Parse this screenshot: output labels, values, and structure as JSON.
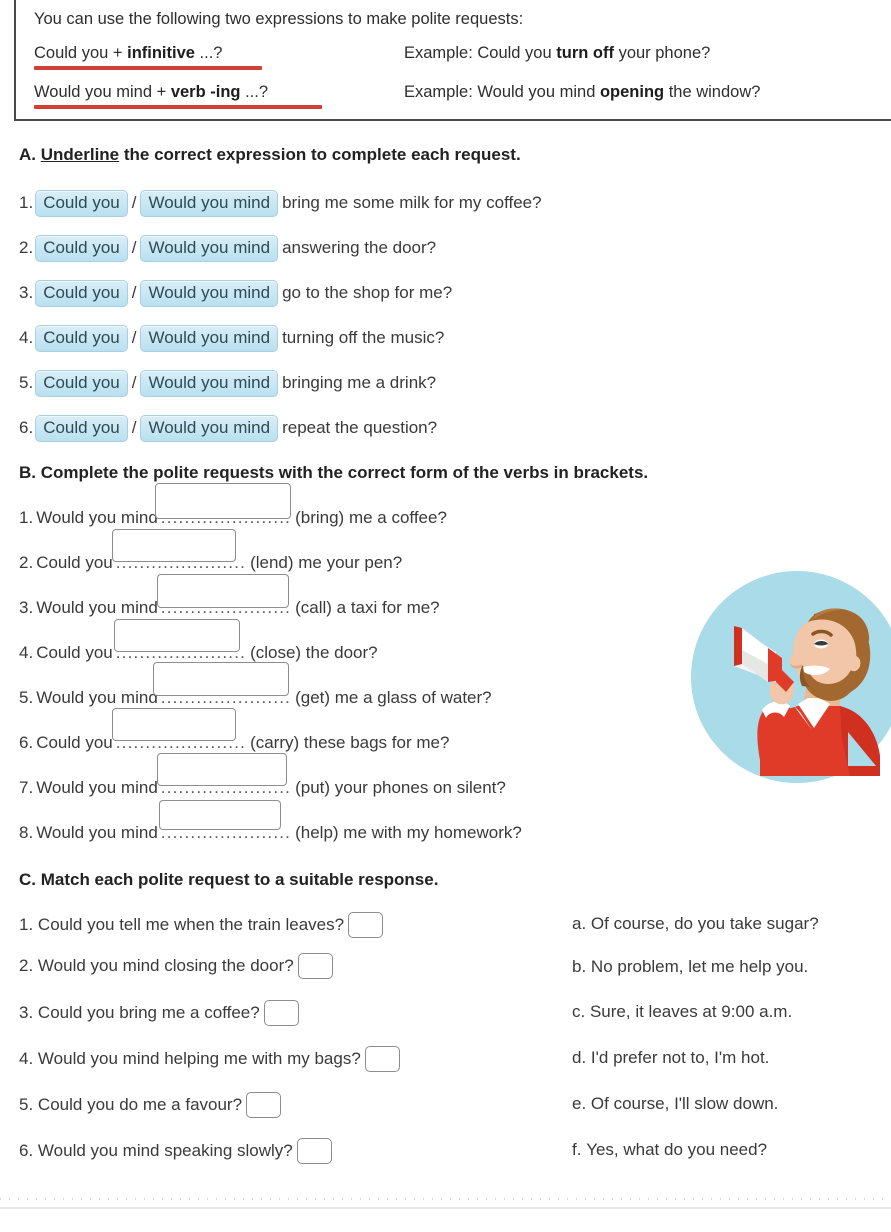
{
  "grammar_box": {
    "intro": "You can use the following two expressions to make polite requests:",
    "rows": [
      {
        "formula_prefix": "Could you + ",
        "formula_bold": "infinitive",
        "formula_suffix": " ...?",
        "example_prefix": "Example: Could you ",
        "example_bold": "turn off",
        "example_suffix": " your phone?"
      },
      {
        "formula_prefix": "Would you mind + ",
        "formula_bold": "verb -ing",
        "formula_suffix": " ...?",
        "example_prefix": "Example: Would you mind ",
        "example_bold": "opening",
        "example_suffix": " the window?"
      }
    ],
    "underline_color": "#cf4035"
  },
  "section_a": {
    "heading_prefix": "A. ",
    "heading_underlined": "Underline",
    "heading_suffix": " the correct expression to complete each request.",
    "option_1": "Could you",
    "option_2": "Would you mind",
    "separator": "/",
    "chip_color": "#b9e0f0",
    "items": [
      {
        "num": "1.",
        "tail": "bring me some milk for my coffee?"
      },
      {
        "num": "2.",
        "tail": "answering the door?"
      },
      {
        "num": "3.",
        "tail": "go to the shop for me?"
      },
      {
        "num": "4.",
        "tail": "turning off the music?"
      },
      {
        "num": "5.",
        "tail": "bringing me a drink?"
      },
      {
        "num": "6.",
        "tail": "repeat the question?"
      }
    ]
  },
  "section_b": {
    "heading": "B. Complete the polite requests with the correct form of the verbs in brackets.",
    "dots": "......................",
    "items": [
      {
        "num": "1.",
        "lead": "Would you mind",
        "tail": "(bring) me a coffee?"
      },
      {
        "num": "2.",
        "lead": "Could you",
        "tail": "(lend) me your pen?"
      },
      {
        "num": "3.",
        "lead": "Would you mind",
        "tail": "(call) a taxi for me?"
      },
      {
        "num": "4.",
        "lead": "Could you",
        "tail": "(close) the door?"
      },
      {
        "num": "5.",
        "lead": "Would you mind",
        "tail": "(get) me a glass of water?"
      },
      {
        "num": "6.",
        "lead": "Could you",
        "tail": "(carry) these bags for me?"
      },
      {
        "num": "7.",
        "lead": "Would you mind",
        "tail": "(put) your phones on silent?"
      },
      {
        "num": "8.",
        "lead": "Would you mind",
        "tail": "(help) me with my homework?"
      }
    ]
  },
  "section_c": {
    "heading": "C. Match each polite request to a suitable response.",
    "prompts": [
      {
        "num": "1.",
        "text": "Could you tell me when the train leaves?",
        "answer": ""
      },
      {
        "num": "2.",
        "text": "Would you mind closing the door?",
        "answer": ""
      },
      {
        "num": "3.",
        "text": "Could you bring me a coffee?",
        "answer": ""
      },
      {
        "num": "4.",
        "text": "Would you mind helping me with my bags?",
        "answer": ""
      },
      {
        "num": "5.",
        "text": "Could you do me a favour?",
        "answer": ""
      },
      {
        "num": "6.",
        "text": "Would you mind speaking slowly?",
        "answer": ""
      }
    ],
    "responses": [
      {
        "letter": "a.",
        "text": "Of course, do you take sugar?"
      },
      {
        "letter": "b.",
        "text": "No problem, let me help you."
      },
      {
        "letter": "c.",
        "text": "Sure, it leaves at 9:00 a.m."
      },
      {
        "letter": "d.",
        "text": "I'd prefer not to, I'm hot."
      },
      {
        "letter": "e.",
        "text": "Of course, I'll slow down."
      },
      {
        "letter": "f.",
        "text": "Yes, what do you need?"
      }
    ]
  },
  "illustration": {
    "name": "man-with-megaphone-illustration",
    "circle_color": "#a9dbe8",
    "shirt_color": "#e03b28",
    "megaphone_color": "#f4f4f2",
    "hair_color": "#a3682f",
    "skin_color": "#f2c6a8"
  }
}
